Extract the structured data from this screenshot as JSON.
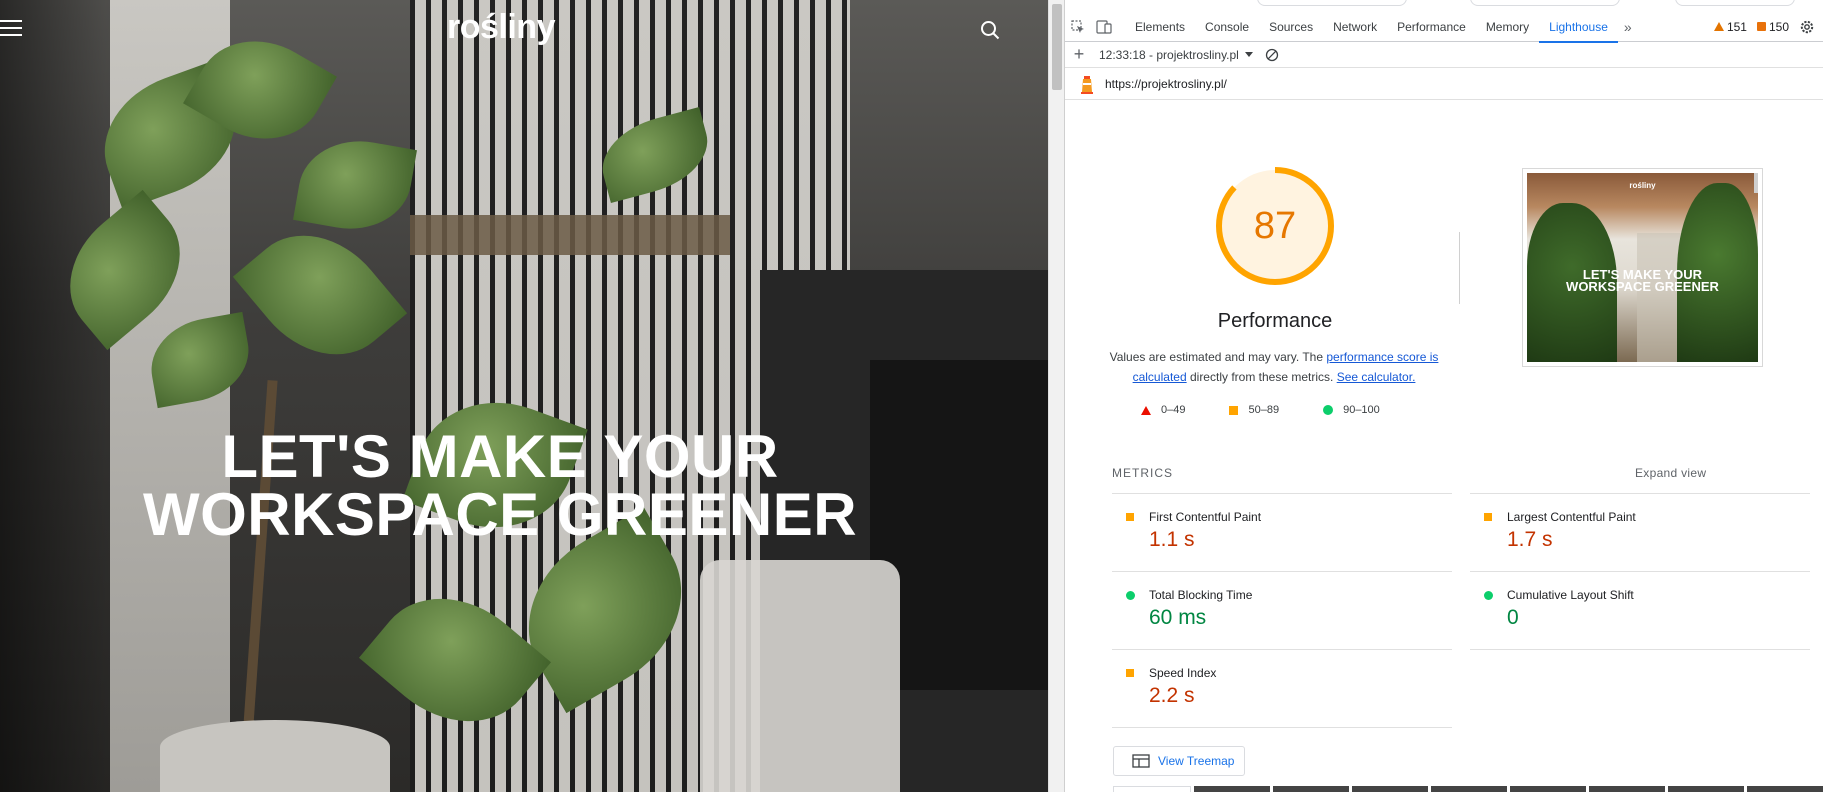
{
  "site": {
    "brand": "rośliny",
    "hero_line1": "LET'S MAKE YOUR",
    "hero_line2": "WORKSPACE GREENER"
  },
  "devtools": {
    "tabs": [
      "Elements",
      "Console",
      "Sources",
      "Network",
      "Performance",
      "Memory",
      "Lighthouse"
    ],
    "active_tab": "Lighthouse",
    "warnings_count": "151",
    "issues_count": "150",
    "report_selector": "12:33:18 - projektrosliny.pl",
    "url": "https://projektrosliny.pl/"
  },
  "report": {
    "score": "87",
    "score_fraction": 0.87,
    "category": "Performance",
    "desc_before": "Values are estimated and may vary. The ",
    "desc_link1": "performance score is calculated",
    "desc_middle": " directly from these metrics. ",
    "desc_link2": "See calculator.",
    "legend": {
      "fail": "0–49",
      "average": "50–89",
      "pass": "90–100"
    },
    "thumb_brand": "rośliny",
    "thumb_line1": "LET'S MAKE YOUR",
    "thumb_line2": "WORKSPACE GREENER",
    "metrics_label": "METRICS",
    "expand_label": "Expand view",
    "metrics": [
      {
        "name": "First Contentful Paint",
        "value": "1.1 s",
        "rating": "average"
      },
      {
        "name": "Largest Contentful Paint",
        "value": "1.7 s",
        "rating": "average"
      },
      {
        "name": "Total Blocking Time",
        "value": "60 ms",
        "rating": "pass"
      },
      {
        "name": "Cumulative Layout Shift",
        "value": "0",
        "rating": "pass"
      },
      {
        "name": "Speed Index",
        "value": "2.2 s",
        "rating": "average"
      }
    ],
    "treemap_label": "View Treemap"
  },
  "colors": {
    "accent": "#1a73e8",
    "gauge_average": "#ffa400",
    "gauge_bg": "#fff3e0",
    "value_average": "#c33300",
    "value_pass": "#018642"
  }
}
